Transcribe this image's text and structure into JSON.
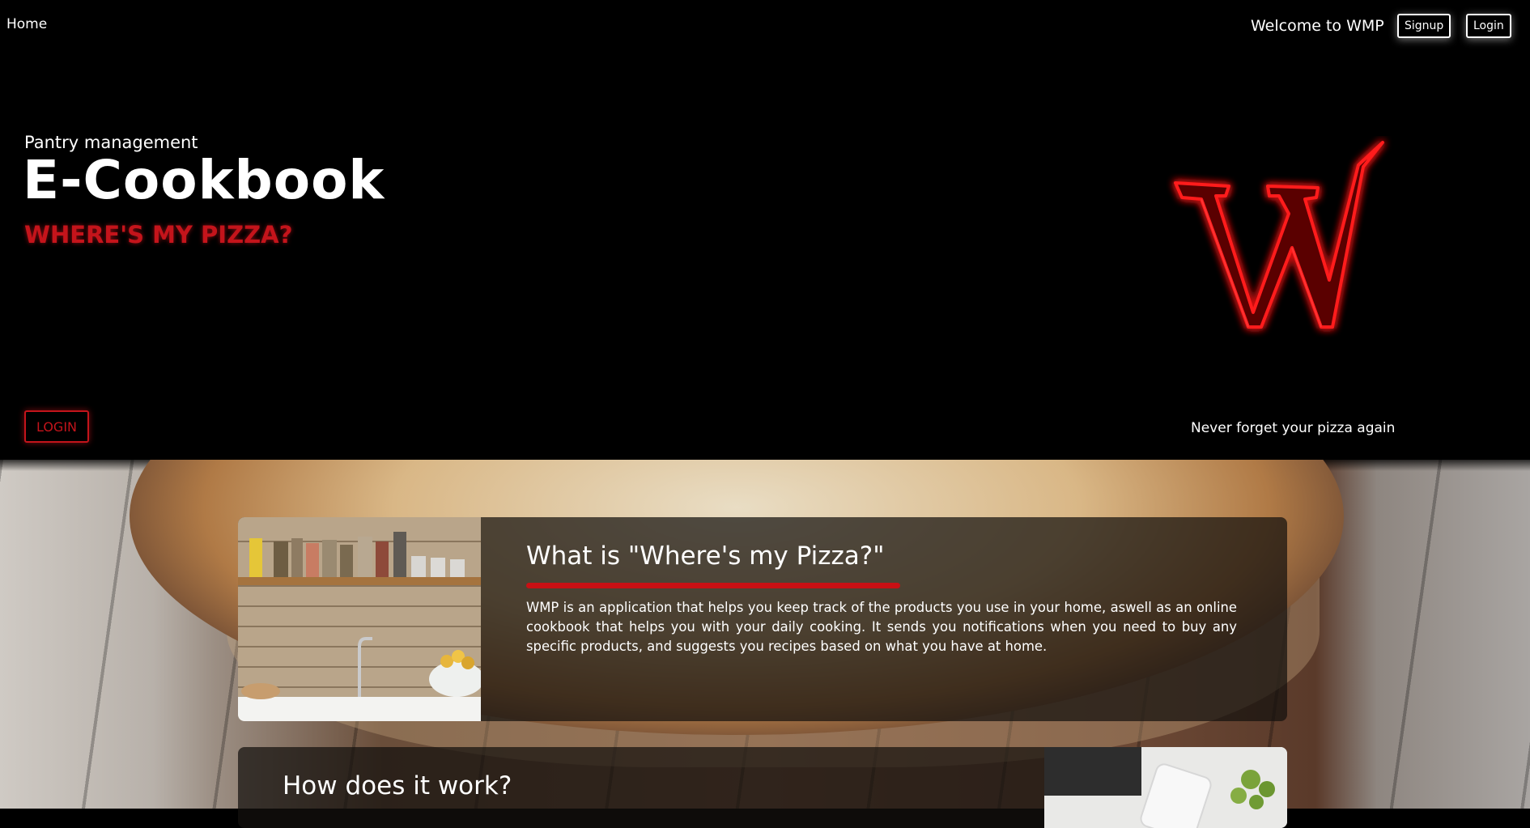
{
  "nav": {
    "home_label": "Home",
    "welcome_text": "Welcome to WMP",
    "signup_label": "Signup",
    "login_label": "Login"
  },
  "hero": {
    "kicker": "Pantry management",
    "title": "E-Cookbook",
    "tagline": "WHERE'S MY PIZZA?",
    "login_button": "LOGIN",
    "slogan": "Never forget your pizza again",
    "logo_letter": "W"
  },
  "sections": [
    {
      "title": "What is \"Where's my Pizza?\"",
      "text": "WMP is an application that helps you keep track of the products you use in your home, aswell as an online cookbook that helps you with your daily cooking. It sends you notifications when you need to buy any specific products, and suggests you recipes based on what you have at home."
    },
    {
      "title": "How does it work?"
    }
  ],
  "colors": {
    "accent_red": "#c4141b",
    "background": "#000000"
  }
}
